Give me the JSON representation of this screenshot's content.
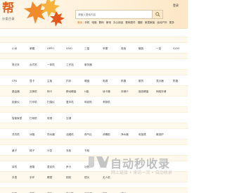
{
  "header": {
    "logo": "帮",
    "logo_sub": "分类目录",
    "search_placeholder": "请输入搜索内容",
    "top_right": "登录"
  },
  "nav": [
    "首页",
    "手机",
    "电脑",
    "数码",
    "家电",
    "办公用品",
    "数码配件",
    "摄影",
    "家居家装",
    "运动户外",
    "更多"
  ],
  "rows": [
    {
      "links": []
    },
    {
      "links": []
    },
    {
      "links": [
        "小米",
        "荣耀",
        "OPPO",
        "VIVO",
        "三星",
        "苹果",
        "真我",
        "魅族",
        "一加",
        "iQOO"
      ]
    },
    {
      "links": []
    },
    {
      "links": [
        "笔记本",
        "台式机",
        "一体机",
        "工作站",
        "服务器"
      ]
    },
    {
      "links": []
    },
    {
      "links": [
        "CPU",
        "显卡",
        "主板",
        "内存",
        "硬盘",
        "电源",
        "机箱",
        "散热",
        "显示器",
        "机箱"
      ]
    },
    {
      "links": [
        "路由器",
        "交换机",
        "网卡",
        "移动硬盘",
        "U盘",
        "读卡器",
        "存储卡",
        "固态硬盘",
        "网络存储"
      ]
    },
    {
      "links": [
        "投影仪",
        "打印机",
        "扫描仪",
        "复印机",
        "碎纸机",
        "考勤机"
      ]
    },
    {
      "links": []
    },
    {
      "links": [
        "智能家居",
        "扫地机",
        "电视",
        "空调"
      ]
    },
    {
      "links": []
    },
    {
      "links": [
        "洗衣机",
        "冰箱",
        "热水器",
        "油烟机",
        "燃气灶",
        "消毒柜",
        "净水器",
        "电饭煲",
        "微波炉"
      ]
    },
    {
      "links": []
    },
    {
      "links": [
        "桌子",
        "椅子",
        "沙发",
        "衣柜",
        "书柜"
      ]
    },
    {
      "links": []
    },
    {
      "links": [
        "耳机",
        "音箱",
        "麦克风",
        "声卡",
        "功放"
      ]
    },
    {
      "links": [
        "手表",
        "手环",
        "眼镜",
        "相机",
        "镜头",
        "无人机"
      ]
    },
    {
      "links": []
    },
    {
      "links": [
        "帐篷",
        "睡袋",
        "背包",
        "登山鞋",
        "户外服",
        "钓鱼",
        "骑行"
      ]
    }
  ],
  "watermark": {
    "title": "自动秒收录",
    "subtitle": "网上链接 • 来访一次 • 自动收录"
  },
  "colors": {
    "accent": "#e0631e",
    "stripe": "#fff8ec",
    "watermark": "#bfbfbf"
  }
}
